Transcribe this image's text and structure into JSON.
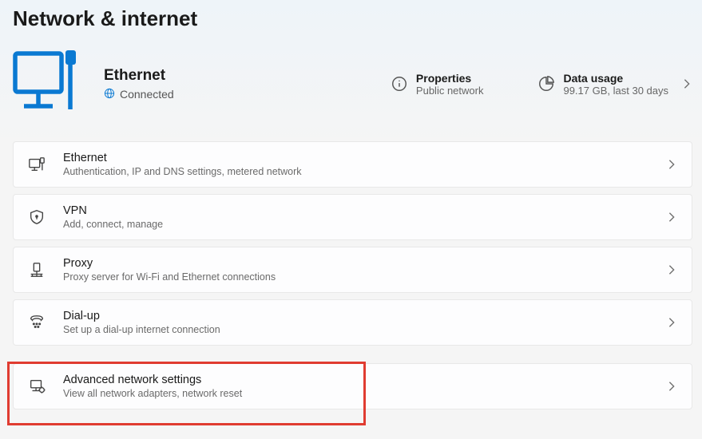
{
  "page": {
    "title": "Network & internet"
  },
  "hero": {
    "name": "Ethernet",
    "status": "Connected",
    "properties": {
      "label": "Properties",
      "sub": "Public network"
    },
    "usage": {
      "label": "Data usage",
      "sub": "99.17 GB, last 30 days"
    }
  },
  "items": [
    {
      "title": "Ethernet",
      "sub": "Authentication, IP and DNS settings, metered network"
    },
    {
      "title": "VPN",
      "sub": "Add, connect, manage"
    },
    {
      "title": "Proxy",
      "sub": "Proxy server for Wi-Fi and Ethernet connections"
    },
    {
      "title": "Dial-up",
      "sub": "Set up a dial-up internet connection"
    },
    {
      "title": "Advanced network settings",
      "sub": "View all network adapters, network reset"
    }
  ]
}
